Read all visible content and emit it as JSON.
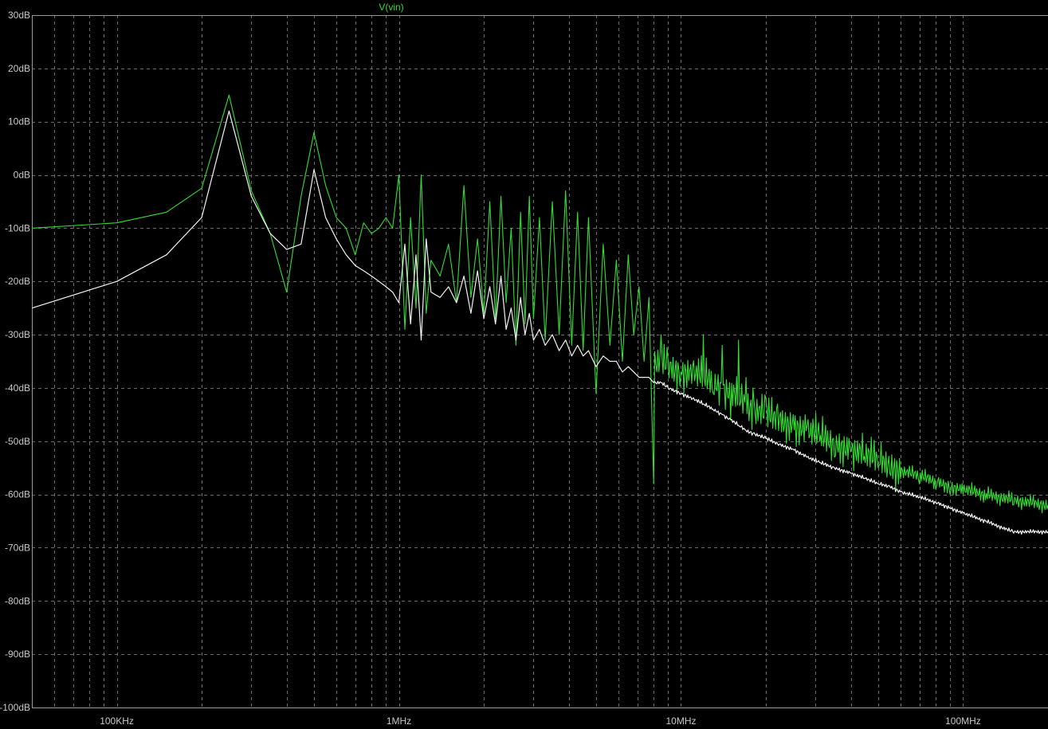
{
  "chart_data": {
    "type": "line",
    "title": "V(vin)",
    "xscale": "log",
    "xlim": [
      50000,
      200000000
    ],
    "ylim": [
      -100,
      30
    ],
    "grid": true,
    "y_ticks": [
      {
        "value": 30,
        "label": "30dB"
      },
      {
        "value": 20,
        "label": "20dB"
      },
      {
        "value": 10,
        "label": "10dB"
      },
      {
        "value": 0,
        "label": "0dB"
      },
      {
        "value": -10,
        "label": "-10dB"
      },
      {
        "value": -20,
        "label": "-20dB"
      },
      {
        "value": -30,
        "label": "-30dB"
      },
      {
        "value": -40,
        "label": "-40dB"
      },
      {
        "value": -50,
        "label": "-50dB"
      },
      {
        "value": -60,
        "label": "-60dB"
      },
      {
        "value": -70,
        "label": "-70dB"
      },
      {
        "value": -80,
        "label": "-80dB"
      },
      {
        "value": -90,
        "label": "-90dB"
      },
      {
        "value": -100,
        "label": "-100dB"
      }
    ],
    "x_ticks": [
      {
        "value": 100000,
        "label": "100KHz"
      },
      {
        "value": 1000000,
        "label": "1MHz"
      },
      {
        "value": 10000000,
        "label": "10MHz"
      },
      {
        "value": 100000000,
        "label": "100MHz"
      }
    ],
    "series": [
      {
        "name": "V(vin)",
        "color": "#33dd33",
        "x": [
          50000,
          100000,
          150000,
          200000,
          250000,
          300000,
          350000,
          400000,
          450000,
          500000,
          550000,
          600000,
          650000,
          700000,
          750000,
          800000,
          850000,
          900000,
          950000,
          1000000,
          1050000,
          1100000,
          1150000,
          1200000,
          1250000,
          1300000,
          1400000,
          1500000,
          1600000,
          1700000,
          1800000,
          1900000,
          2000000,
          2100000,
          2200000,
          2300000,
          2400000,
          2500000,
          2600000,
          2700000,
          2800000,
          2900000,
          3000000,
          3150000,
          3300000,
          3500000,
          3700000,
          3900000,
          4100000,
          4300000,
          4500000,
          4700000,
          5000000,
          5300000,
          5600000,
          5900000,
          6200000,
          6500000,
          6800000,
          7100000,
          7400000,
          7700000,
          8000000,
          8500000,
          9000000,
          10000000,
          11000000,
          12000000,
          13000000,
          14000000,
          15000000,
          16000000,
          17000000,
          18000000,
          20000000,
          22000000,
          25000000,
          28000000,
          31000000,
          35000000,
          40000000,
          45000000,
          50000000,
          55000000,
          60000000,
          70000000,
          80000000,
          90000000,
          100000000,
          120000000,
          150000000,
          200000000
        ],
        "values": [
          -10,
          -9,
          -7,
          -2.5,
          15,
          -3,
          -11,
          -22,
          -4,
          8,
          -2,
          -8,
          -10,
          -15,
          -9,
          -11,
          -10,
          -8,
          -10,
          0,
          -29,
          -8,
          -25,
          0,
          -26,
          -16,
          -19,
          -13,
          -24,
          -2,
          -23,
          -12,
          -26,
          -5,
          -27,
          -4,
          -24,
          -10,
          -32,
          -7,
          -28,
          -4,
          -27,
          -8,
          -31,
          -5,
          -30,
          -3,
          -32,
          -7,
          -33,
          -8,
          -41,
          -13,
          -32,
          -16,
          -35,
          -15,
          -30,
          -21,
          -35,
          -23,
          -58,
          -30,
          -35,
          -37,
          -36,
          -30,
          -41,
          -32,
          -46,
          -31,
          -38,
          -40,
          -42,
          -43,
          -45,
          -47,
          -50,
          -53,
          -52,
          -54,
          -55,
          -56,
          -57,
          -58,
          -59,
          -60,
          -60,
          -61,
          -62,
          -62
        ],
        "mean": [
          -10,
          -9,
          -7,
          -2.5,
          15,
          -3,
          -11,
          -22,
          -4,
          8,
          -2,
          -8,
          -10,
          -15,
          -9,
          -11,
          -10,
          -8,
          -10,
          -8,
          -15,
          -12,
          -18,
          -13,
          -18,
          -17,
          -19,
          -18,
          -20,
          -17,
          -21,
          -20,
          -22,
          -19,
          -23,
          -20,
          -23,
          -22,
          -26,
          -22,
          -25,
          -22,
          -25,
          -23,
          -27,
          -24,
          -27,
          -25,
          -28,
          -27,
          -29,
          -28,
          -30,
          -29,
          -30,
          -31,
          -31,
          -32,
          -32,
          -33,
          -33,
          -34,
          -35,
          -35,
          -36,
          -37,
          -37,
          -38,
          -39,
          -40,
          -41,
          -42,
          -43,
          -44,
          -45,
          -46,
          -47,
          -48,
          -49,
          -50.5,
          -51.5,
          -52.5,
          -53.5,
          -54.5,
          -55.5,
          -56.5,
          -57.5,
          -58.5,
          -59,
          -60,
          -61,
          -62
        ]
      },
      {
        "name": "",
        "color": "#f2f2f2",
        "x": [
          50000,
          100000,
          150000,
          200000,
          250000,
          300000,
          350000,
          400000,
          450000,
          500000,
          550000,
          600000,
          650000,
          700000,
          750000,
          800000,
          850000,
          900000,
          950000,
          1000000,
          1050000,
          1100000,
          1150000,
          1200000,
          1250000,
          1300000,
          1400000,
          1500000,
          1600000,
          1700000,
          1800000,
          1900000,
          2000000,
          2100000,
          2200000,
          2300000,
          2400000,
          2500000,
          2600000,
          2700000,
          2800000,
          2900000,
          3000000,
          3150000,
          3300000,
          3500000,
          3700000,
          3900000,
          4100000,
          4300000,
          4500000,
          4700000,
          5000000,
          5300000,
          5600000,
          5900000,
          6200000,
          6500000,
          6800000,
          7100000,
          7400000,
          7700000,
          8000000,
          8500000,
          9000000,
          10000000,
          11000000,
          12000000,
          13000000,
          14000000,
          15000000,
          16000000,
          17000000,
          18000000,
          20000000,
          22000000,
          25000000,
          28000000,
          31000000,
          35000000,
          40000000,
          45000000,
          50000000,
          55000000,
          60000000,
          70000000,
          80000000,
          90000000,
          100000000,
          120000000,
          150000000,
          200000000
        ],
        "values": [
          -25,
          -20,
          -15,
          -8,
          12,
          -4,
          -11,
          -14,
          -13,
          1,
          -8,
          -12,
          -15,
          -17,
          -18,
          -19,
          -20,
          -21,
          -22,
          -24,
          -13,
          -28,
          -15,
          -31,
          -12,
          -22,
          -23,
          -21,
          -24,
          -19,
          -26,
          -18,
          -27,
          -21,
          -28,
          -19,
          -29,
          -25,
          -31,
          -23,
          -30,
          -26,
          -31,
          -29,
          -32,
          -30,
          -33,
          -31,
          -34,
          -32,
          -34,
          -33,
          -36,
          -34,
          -35,
          -35,
          -37,
          -36,
          -37,
          -38,
          -38,
          -38,
          -39,
          -39,
          -40,
          -41,
          -42,
          -43,
          -44,
          -45,
          -46,
          -47,
          -48,
          -48.5,
          -49.5,
          -50.5,
          -51.5,
          -53,
          -54,
          -55,
          -56,
          -57,
          -58,
          -58.5,
          -59.5,
          -60.5,
          -61.5,
          -62.5,
          -63.5,
          -65,
          -67,
          -67
        ]
      }
    ]
  }
}
